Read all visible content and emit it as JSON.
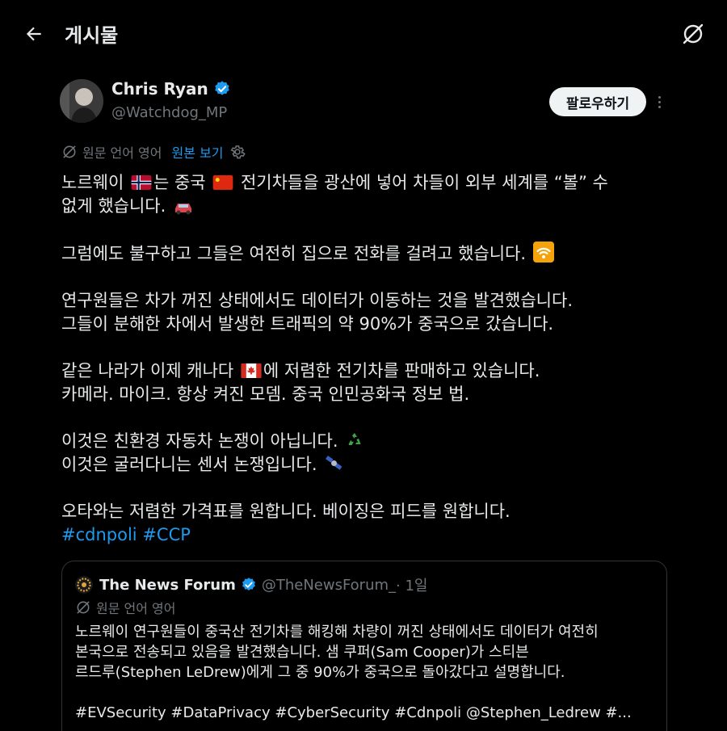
{
  "header": {
    "title": "게시물",
    "back_icon": "arrow-left-icon",
    "translate_icon": "translate-off-icon"
  },
  "author": {
    "name": "Chris Ryan",
    "handle": "@Watchdog_MP",
    "follow_label": "팔로우하기"
  },
  "translation": {
    "source_text": "원문 언어 영어",
    "show_original": "원본 보기"
  },
  "tweet": {
    "line1a": "노르웨이 ",
    "line1b": "는 중국 ",
    "line1c": " 전기차들을 광산에 넣어 차들이 외부 세계를 “볼” 수",
    "line2": "없게 했습니다.",
    "line3": "그럼에도 불구하고 그들은 여전히 집으로 전화를 걸려고 했습니다.",
    "line4": "연구원들은 차가 꺼진 상태에서도 데이터가 이동하는 것을 발견했습니다.",
    "line5": "그들이 분해한 차에서 발생한 트래픽의 약 90%가 중국으로 갔습니다.",
    "line6a": "같은 나라가 이제 캐나다 ",
    "line6b": "에 저렴한 전기차를 판매하고 있습니다.",
    "line7": "카메라. 마이크. 항상 켜진 모뎀. 중국 인민공화국 정보 법.",
    "line8": "이것은 친환경 자동차 논쟁이 아닙니다.",
    "line9": "이것은 굴러다니는 센서 논쟁입니다.",
    "line10": "오타와는 저렴한 가격표를 원합니다. 베이징은 피드를 원합니다.",
    "hashtag1": "#cdnpoli",
    "hashtag2": "#CCP"
  },
  "quote": {
    "name": "The News Forum",
    "handle": "@TheNewsForum_",
    "time": " · 1일",
    "source_text": "원문 언어 영어",
    "line1": "노르웨이 연구원들이 중국산 전기차를 해킹해 차량이 꺼진 상태에서도 데이터가 여전히",
    "line2": "본국으로 전송되고 있음을 발견했습니다. 샘 쿠퍼(Sam Cooper)가 스티븐",
    "line3": "르드루(Stephen LeDrew)에게 그 중 90%가 중국으로 돌아갔다고 설명합니다.",
    "tags": "#EVSecurity #DataPrivacy #CyberSecurity #Cdnpoli @Stephen_Ledrew #..."
  },
  "colors": {
    "accent": "#1d9bf0",
    "muted": "#71767b",
    "text": "#e7e9ea",
    "background": "#000000"
  }
}
